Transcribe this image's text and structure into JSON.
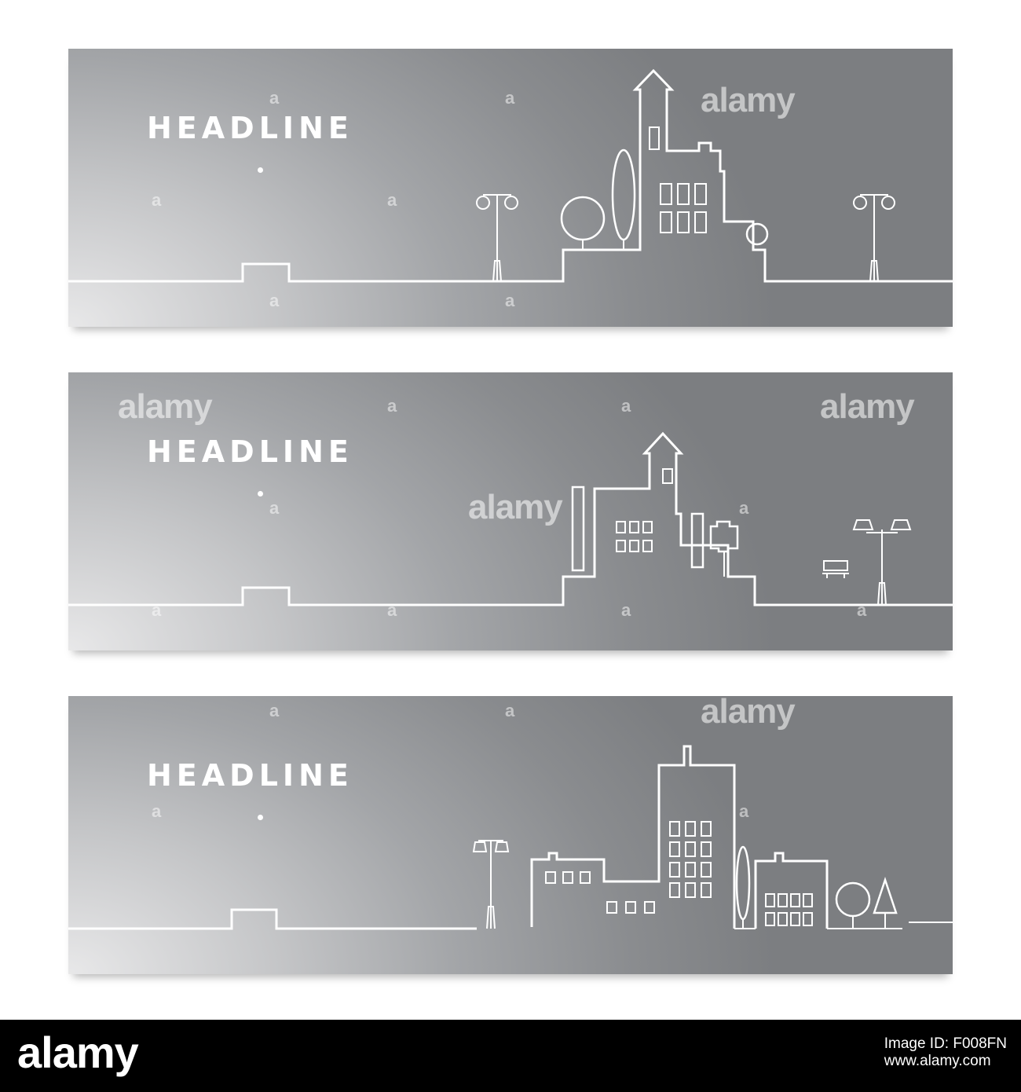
{
  "banners": [
    {
      "headline": "HEADLINE"
    },
    {
      "headline": "HEADLINE"
    },
    {
      "headline": "HEADLINE"
    }
  ],
  "watermark": {
    "text": "alamy",
    "letter": "a"
  },
  "footer": {
    "logo": "alamy",
    "image_id": "Image ID: F008FN",
    "url": "www.alamy.com"
  },
  "colors": {
    "banner_dark": "#7c7e81",
    "banner_light": "#e8e8e9",
    "line_art": "#ffffff",
    "footer_bg": "#000000"
  }
}
